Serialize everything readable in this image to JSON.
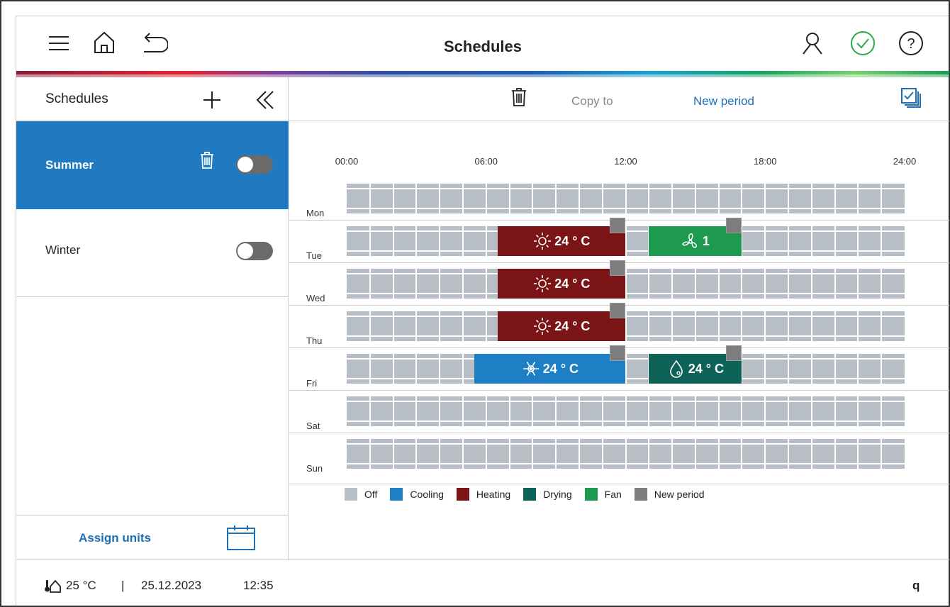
{
  "header": {
    "title": "Schedules"
  },
  "sidebar": {
    "title": "Schedules",
    "items": [
      {
        "name": "Summer",
        "active": true,
        "enabled": false
      },
      {
        "name": "Winter",
        "active": false,
        "enabled": false
      }
    ],
    "assign_label": "Assign units"
  },
  "toolbar": {
    "copy_label": "Copy to",
    "new_period_label": "New period"
  },
  "hours": [
    "00:00",
    "06:00",
    "12:00",
    "18:00",
    "24:00"
  ],
  "days": [
    "Mon",
    "Tue",
    "Wed",
    "Thu",
    "Fri",
    "Sat",
    "Sun"
  ],
  "periods": [
    {
      "day": "Tue",
      "start": "06:30",
      "end": "12:00",
      "mode": "Heating",
      "icon": "sun-icon",
      "label": "24 ° C"
    },
    {
      "day": "Tue",
      "start": "13:00",
      "end": "17:00",
      "mode": "Fan",
      "icon": "fan-icon",
      "label": "1"
    },
    {
      "day": "Wed",
      "start": "06:30",
      "end": "12:00",
      "mode": "Heating",
      "icon": "sun-icon",
      "label": "24 ° C"
    },
    {
      "day": "Thu",
      "start": "06:30",
      "end": "12:00",
      "mode": "Heating",
      "icon": "sun-icon",
      "label": "24 ° C"
    },
    {
      "day": "Fri",
      "start": "05:30",
      "end": "12:00",
      "mode": "Cooling",
      "icon": "snowflake-icon",
      "label": "24 ° C"
    },
    {
      "day": "Fri",
      "start": "13:00",
      "end": "17:00",
      "mode": "Drying",
      "icon": "drop-icon",
      "label": "24 ° C"
    }
  ],
  "legend": [
    {
      "label": "Off",
      "color": "#b8bec5"
    },
    {
      "label": "Cooling",
      "color": "#1f7fc4"
    },
    {
      "label": "Heating",
      "color": "#7a1416"
    },
    {
      "label": "Drying",
      "color": "#0f6258"
    },
    {
      "label": "Fan",
      "color": "#1e9a50"
    },
    {
      "label": "New period",
      "color": "#7d7d7d"
    }
  ],
  "colors": {
    "accent": "#1f6fb5",
    "active_bg": "#1f7ac2",
    "check": "#2aa84a"
  },
  "footer": {
    "temperature": "25 °C",
    "separator": "|",
    "date": "25.12.2023",
    "time": "12:35",
    "right": "q"
  }
}
